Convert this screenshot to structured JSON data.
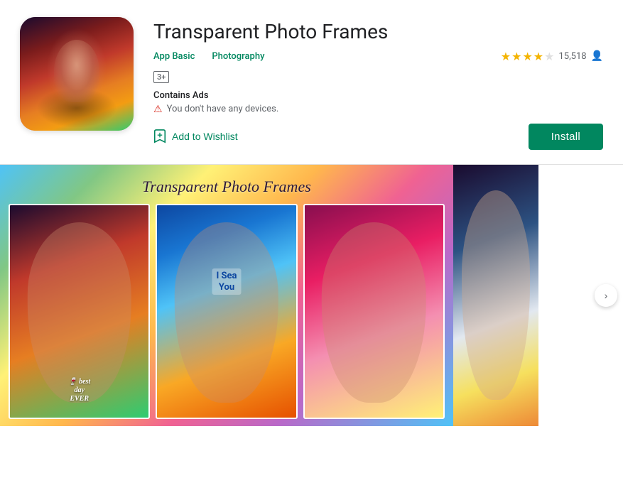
{
  "app": {
    "title": "Transparent Photo Frames",
    "developer": "App Basic",
    "category": "Photography",
    "age_rating": "3+",
    "rating_value": "4",
    "rating_count": "15,518",
    "contains_ads": "Contains Ads",
    "warning_message": "You don't have any devices.",
    "wishlist_label": "Add to Wishlist",
    "install_label": "Install"
  },
  "screenshots": {
    "title_overlay": "Transparent Photo Frames",
    "frame1_text": "best\nday\nEVER",
    "frame2_text": "I Sea\nYou",
    "nav_arrow": "›"
  },
  "colors": {
    "green": "#01875f",
    "star_filled": "#f4b400",
    "star_empty": "#e0e0e0",
    "warning_red": "#d93025",
    "text_dark": "#202124",
    "text_muted": "#5f6368"
  }
}
